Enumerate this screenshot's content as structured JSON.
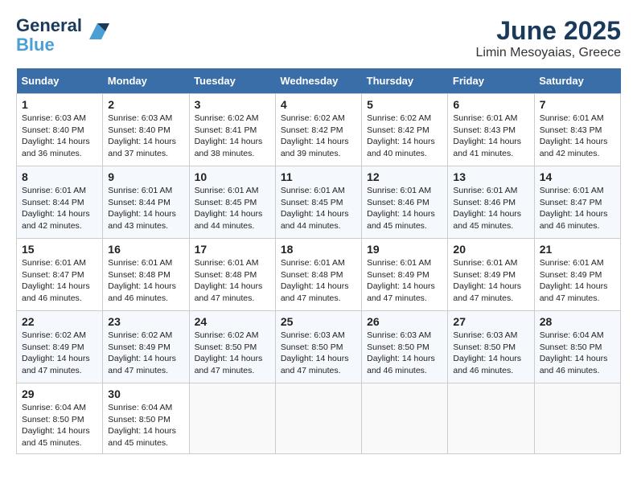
{
  "header": {
    "logo_line1": "General",
    "logo_line2": "Blue",
    "title": "June 2025",
    "subtitle": "Limin Mesoyaias, Greece"
  },
  "days_of_week": [
    "Sunday",
    "Monday",
    "Tuesday",
    "Wednesday",
    "Thursday",
    "Friday",
    "Saturday"
  ],
  "weeks": [
    [
      {
        "day": 1,
        "lines": [
          "Sunrise: 6:03 AM",
          "Sunset: 8:40 PM",
          "Daylight: 14 hours",
          "and 36 minutes."
        ]
      },
      {
        "day": 2,
        "lines": [
          "Sunrise: 6:03 AM",
          "Sunset: 8:40 PM",
          "Daylight: 14 hours",
          "and 37 minutes."
        ]
      },
      {
        "day": 3,
        "lines": [
          "Sunrise: 6:02 AM",
          "Sunset: 8:41 PM",
          "Daylight: 14 hours",
          "and 38 minutes."
        ]
      },
      {
        "day": 4,
        "lines": [
          "Sunrise: 6:02 AM",
          "Sunset: 8:42 PM",
          "Daylight: 14 hours",
          "and 39 minutes."
        ]
      },
      {
        "day": 5,
        "lines": [
          "Sunrise: 6:02 AM",
          "Sunset: 8:42 PM",
          "Daylight: 14 hours",
          "and 40 minutes."
        ]
      },
      {
        "day": 6,
        "lines": [
          "Sunrise: 6:01 AM",
          "Sunset: 8:43 PM",
          "Daylight: 14 hours",
          "and 41 minutes."
        ]
      },
      {
        "day": 7,
        "lines": [
          "Sunrise: 6:01 AM",
          "Sunset: 8:43 PM",
          "Daylight: 14 hours",
          "and 42 minutes."
        ]
      }
    ],
    [
      {
        "day": 8,
        "lines": [
          "Sunrise: 6:01 AM",
          "Sunset: 8:44 PM",
          "Daylight: 14 hours",
          "and 42 minutes."
        ]
      },
      {
        "day": 9,
        "lines": [
          "Sunrise: 6:01 AM",
          "Sunset: 8:44 PM",
          "Daylight: 14 hours",
          "and 43 minutes."
        ]
      },
      {
        "day": 10,
        "lines": [
          "Sunrise: 6:01 AM",
          "Sunset: 8:45 PM",
          "Daylight: 14 hours",
          "and 44 minutes."
        ]
      },
      {
        "day": 11,
        "lines": [
          "Sunrise: 6:01 AM",
          "Sunset: 8:45 PM",
          "Daylight: 14 hours",
          "and 44 minutes."
        ]
      },
      {
        "day": 12,
        "lines": [
          "Sunrise: 6:01 AM",
          "Sunset: 8:46 PM",
          "Daylight: 14 hours",
          "and 45 minutes."
        ]
      },
      {
        "day": 13,
        "lines": [
          "Sunrise: 6:01 AM",
          "Sunset: 8:46 PM",
          "Daylight: 14 hours",
          "and 45 minutes."
        ]
      },
      {
        "day": 14,
        "lines": [
          "Sunrise: 6:01 AM",
          "Sunset: 8:47 PM",
          "Daylight: 14 hours",
          "and 46 minutes."
        ]
      }
    ],
    [
      {
        "day": 15,
        "lines": [
          "Sunrise: 6:01 AM",
          "Sunset: 8:47 PM",
          "Daylight: 14 hours",
          "and 46 minutes."
        ]
      },
      {
        "day": 16,
        "lines": [
          "Sunrise: 6:01 AM",
          "Sunset: 8:48 PM",
          "Daylight: 14 hours",
          "and 46 minutes."
        ]
      },
      {
        "day": 17,
        "lines": [
          "Sunrise: 6:01 AM",
          "Sunset: 8:48 PM",
          "Daylight: 14 hours",
          "and 47 minutes."
        ]
      },
      {
        "day": 18,
        "lines": [
          "Sunrise: 6:01 AM",
          "Sunset: 8:48 PM",
          "Daylight: 14 hours",
          "and 47 minutes."
        ]
      },
      {
        "day": 19,
        "lines": [
          "Sunrise: 6:01 AM",
          "Sunset: 8:49 PM",
          "Daylight: 14 hours",
          "and 47 minutes."
        ]
      },
      {
        "day": 20,
        "lines": [
          "Sunrise: 6:01 AM",
          "Sunset: 8:49 PM",
          "Daylight: 14 hours",
          "and 47 minutes."
        ]
      },
      {
        "day": 21,
        "lines": [
          "Sunrise: 6:01 AM",
          "Sunset: 8:49 PM",
          "Daylight: 14 hours",
          "and 47 minutes."
        ]
      }
    ],
    [
      {
        "day": 22,
        "lines": [
          "Sunrise: 6:02 AM",
          "Sunset: 8:49 PM",
          "Daylight: 14 hours",
          "and 47 minutes."
        ]
      },
      {
        "day": 23,
        "lines": [
          "Sunrise: 6:02 AM",
          "Sunset: 8:49 PM",
          "Daylight: 14 hours",
          "and 47 minutes."
        ]
      },
      {
        "day": 24,
        "lines": [
          "Sunrise: 6:02 AM",
          "Sunset: 8:50 PM",
          "Daylight: 14 hours",
          "and 47 minutes."
        ]
      },
      {
        "day": 25,
        "lines": [
          "Sunrise: 6:03 AM",
          "Sunset: 8:50 PM",
          "Daylight: 14 hours",
          "and 47 minutes."
        ]
      },
      {
        "day": 26,
        "lines": [
          "Sunrise: 6:03 AM",
          "Sunset: 8:50 PM",
          "Daylight: 14 hours",
          "and 46 minutes."
        ]
      },
      {
        "day": 27,
        "lines": [
          "Sunrise: 6:03 AM",
          "Sunset: 8:50 PM",
          "Daylight: 14 hours",
          "and 46 minutes."
        ]
      },
      {
        "day": 28,
        "lines": [
          "Sunrise: 6:04 AM",
          "Sunset: 8:50 PM",
          "Daylight: 14 hours",
          "and 46 minutes."
        ]
      }
    ],
    [
      {
        "day": 29,
        "lines": [
          "Sunrise: 6:04 AM",
          "Sunset: 8:50 PM",
          "Daylight: 14 hours",
          "and 45 minutes."
        ]
      },
      {
        "day": 30,
        "lines": [
          "Sunrise: 6:04 AM",
          "Sunset: 8:50 PM",
          "Daylight: 14 hours",
          "and 45 minutes."
        ]
      },
      null,
      null,
      null,
      null,
      null
    ]
  ]
}
